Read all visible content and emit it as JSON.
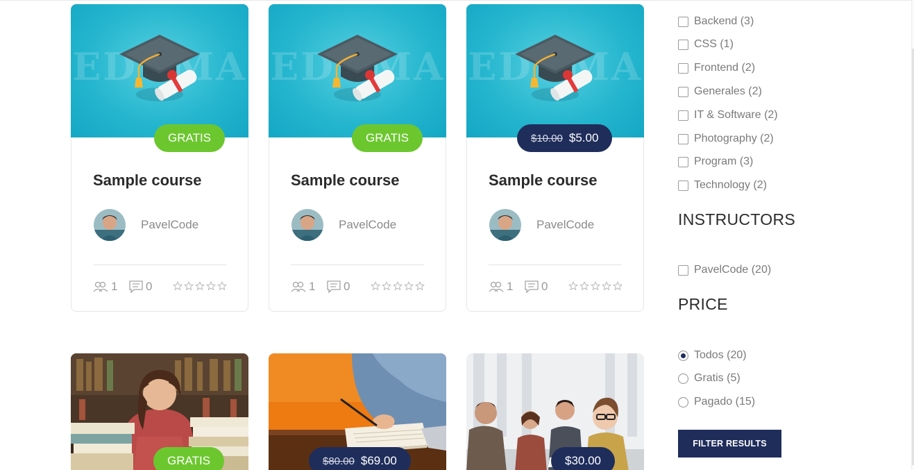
{
  "colors": {
    "accent": "#1f2d5b",
    "free_badge": "#6cc72f",
    "thumbnail_bg": "#26b7cf"
  },
  "courses_row1": [
    {
      "watermark": "EDUMA",
      "badge_label": "GRATIS",
      "badge_type": "free",
      "title": "Sample course",
      "instructor": "PavelCode",
      "students": "1",
      "comments": "0",
      "rating": 0
    },
    {
      "watermark": "EDUMA",
      "badge_label": "GRATIS",
      "badge_type": "free",
      "title": "Sample course",
      "instructor": "PavelCode",
      "students": "1",
      "comments": "0",
      "rating": 0
    },
    {
      "watermark": "EDUMA",
      "old_price": "$10.00",
      "badge_label": "$5.00",
      "badge_type": "paid",
      "title": "Sample course",
      "instructor": "PavelCode",
      "students": "1",
      "comments": "0",
      "rating": 0
    }
  ],
  "courses_row2": [
    {
      "badge_label": "GRATIS",
      "badge_type": "free"
    },
    {
      "old_price": "$80.00",
      "badge_label": "$69.00",
      "badge_type": "paid"
    },
    {
      "badge_label": "$30.00",
      "badge_type": "paid"
    }
  ],
  "sidebar": {
    "categories": [
      {
        "label": "Backend (3)",
        "checked": false
      },
      {
        "label": "CSS (1)",
        "checked": false
      },
      {
        "label": "Frontend (2)",
        "checked": false
      },
      {
        "label": "Generales (2)",
        "checked": false
      },
      {
        "label": "IT & Software (2)",
        "checked": false
      },
      {
        "label": "Photography (2)",
        "checked": false
      },
      {
        "label": "Program (3)",
        "checked": false
      },
      {
        "label": "Technology (2)",
        "checked": false
      }
    ],
    "instructors_heading": "INSTRUCTORS",
    "instructors": [
      {
        "label": "PavelCode (20)",
        "checked": false
      }
    ],
    "price_heading": "PRICE",
    "price_options": [
      {
        "label": "Todos (20)",
        "selected": true
      },
      {
        "label": "Gratis (5)",
        "selected": false
      },
      {
        "label": "Pagado (15)",
        "selected": false
      }
    ],
    "filter_button": "FILTER RESULTS"
  }
}
